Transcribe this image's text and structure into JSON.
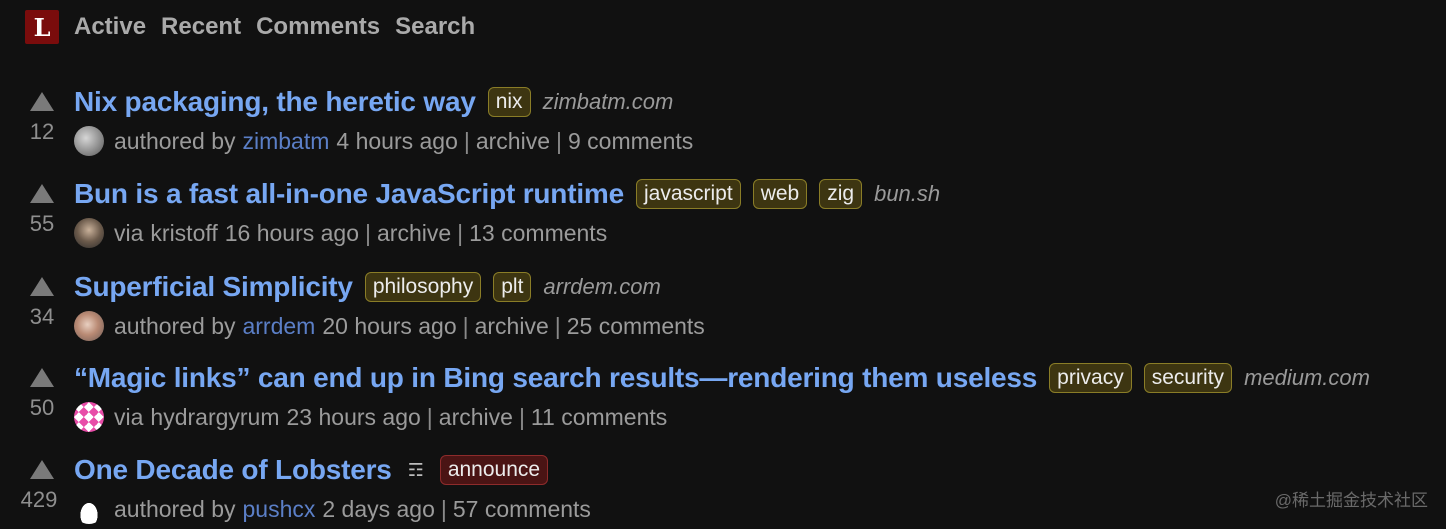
{
  "nav": {
    "logo_letter": "L",
    "links": [
      "Active",
      "Recent",
      "Comments",
      "Search"
    ]
  },
  "stories": [
    {
      "score": "12",
      "title": "Nix packaging, the heretic way",
      "tags": [
        "nix"
      ],
      "domain": "zimbatm.com",
      "byline_prefix": "authored by",
      "user": "zimbatm",
      "time": "4 hours ago",
      "archive": "archive",
      "comments": "9 comments"
    },
    {
      "score": "55",
      "title": "Bun is a fast all-in-one JavaScript runtime",
      "tags": [
        "javascript",
        "web",
        "zig"
      ],
      "domain": "bun.sh",
      "byline_prefix": "via",
      "user": "kristoff",
      "time": "16 hours ago",
      "archive": "archive",
      "comments": "13 comments"
    },
    {
      "score": "34",
      "title": "Superficial Simplicity",
      "tags": [
        "philosophy",
        "plt"
      ],
      "domain": "arrdem.com",
      "byline_prefix": "authored by",
      "user": "arrdem",
      "time": "20 hours ago",
      "archive": "archive",
      "comments": "25 comments"
    },
    {
      "score": "50",
      "title": "“Magic links” can end up in Bing search results—rendering them useless",
      "tags": [
        "privacy",
        "security"
      ],
      "domain": "medium.com",
      "byline_prefix": "via",
      "user": "hydrargyrum",
      "time": "23 hours ago",
      "archive": "archive",
      "comments": "11 comments"
    },
    {
      "score": "429",
      "title": "One Decade of Lobsters",
      "description_icon": "☶",
      "tags": [
        "announce"
      ],
      "byline_prefix": "authored by",
      "user": "pushcx",
      "time": "2 days ago",
      "comments": "57 comments"
    }
  ],
  "watermark": "@稀土掘金技术社区",
  "colors": {
    "background": "#111111",
    "title_link": "#77a7f2",
    "user_link": "#5b7fc7",
    "tag_bg": "#3d3511",
    "tag_border": "#8a7d27",
    "announce_tag_bg": "#4a1414",
    "logo_bg": "#7a0c0c"
  }
}
